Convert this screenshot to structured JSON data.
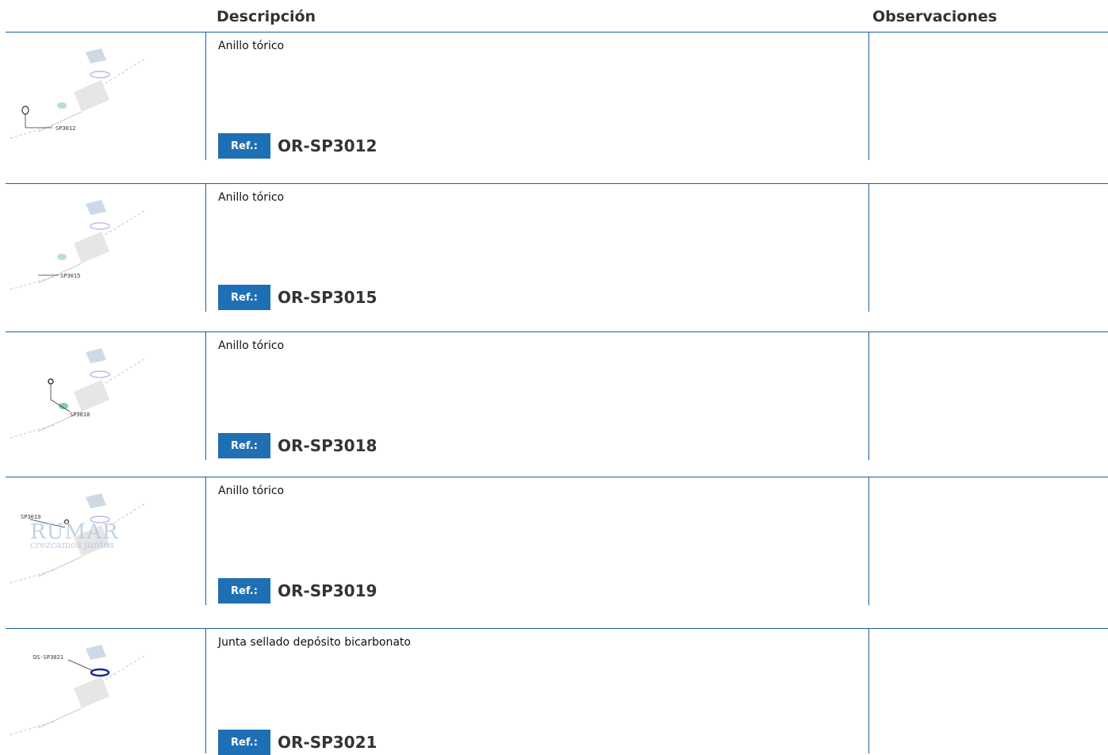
{
  "header": {
    "description": "Descripción",
    "observations": "Observaciones"
  },
  "ref_label": "Ref.:",
  "rows": [
    {
      "description": "Anillo tórico",
      "ref": "OR-SP3012",
      "part_label": "SP3012",
      "observations": ""
    },
    {
      "description": "Anillo tórico",
      "ref": "OR-SP3015",
      "part_label": "SP3015",
      "observations": ""
    },
    {
      "description": "Anillo tórico",
      "ref": "OR-SP3018",
      "part_label": "SP3018",
      "observations": ""
    },
    {
      "description": "Anillo tórico",
      "ref": "OR-SP3019",
      "part_label": "SP3019",
      "observations": ""
    },
    {
      "description": "Junta sellado depósito bicarbonato",
      "ref": "OR-SP3021",
      "part_label": "DS-SP3021",
      "observations": ""
    }
  ],
  "watermark": {
    "name": "RUMAR",
    "tagline": "crezcamos juntos"
  },
  "colors": {
    "accent": "#1f6fb5",
    "line": "#1f5f9c"
  }
}
